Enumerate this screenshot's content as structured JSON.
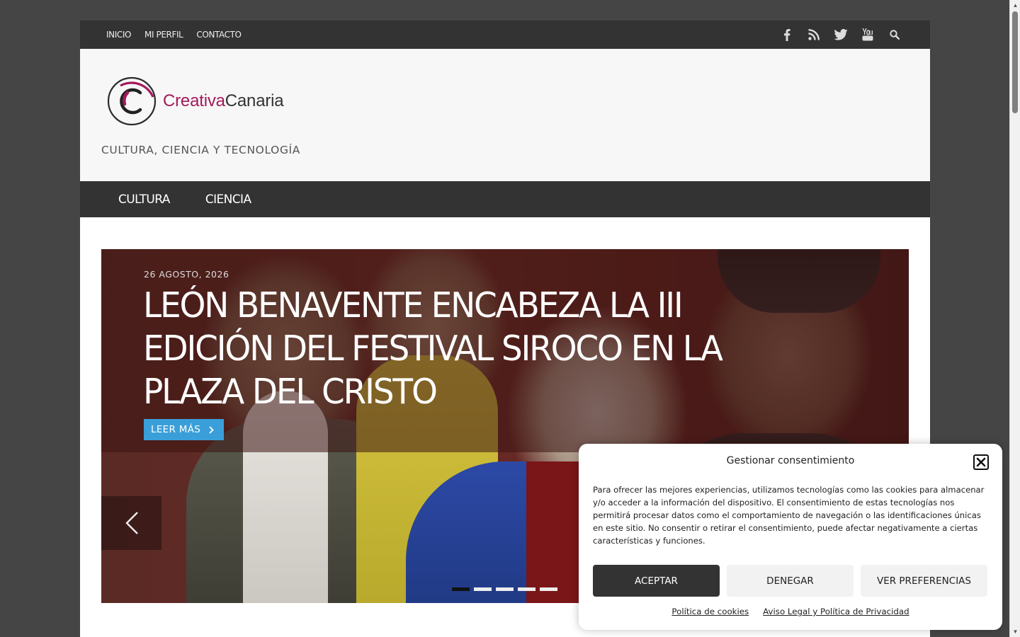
{
  "topbar": {
    "nav": [
      "INICIO",
      "MI PERFIL",
      "CONTACTO"
    ],
    "social_icons": [
      "facebook-icon",
      "rss-icon",
      "twitter-icon",
      "youtube-icon",
      "search-icon"
    ]
  },
  "header": {
    "logo_part1": "Creativa",
    "logo_part2": "Canaria",
    "tagline": "CULTURA, CIENCIA Y TECNOLOGÍA"
  },
  "main_nav": [
    "CULTURA",
    "CIENCIA"
  ],
  "slider": {
    "date": "26 AGOSTO, 2026",
    "title": "LEÓN BENAVENTE ENCABEZA LA III EDICIÓN DEL FESTIVAL SIROCO EN LA PLAZA DEL CRISTO",
    "read_more": "LEER MÁS",
    "slide_count": 5,
    "active_slide": 1
  },
  "colors": {
    "bar": "#333333",
    "accent_blue": "#3a9fd8",
    "brand_magenta": "#a3195b"
  },
  "cookie": {
    "title": "Gestionar consentimiento",
    "body": "Para ofrecer las mejores experiencias, utilizamos tecnologías como las cookies para almacenar y/o acceder a la información del dispositivo. El consentimiento de estas tecnologías nos permitirá procesar datos como el comportamiento de navegación o las identificaciones únicas en este sitio. No consentir o retirar el consentimiento, puede afectar negativamente a ciertas características y funciones.",
    "accept": "ACEPTAR",
    "deny": "DENEGAR",
    "preferences": "VER PREFERENCIAS",
    "link_cookies": "Política de cookies",
    "link_legal": "Aviso Legal y Política de Privacidad"
  }
}
